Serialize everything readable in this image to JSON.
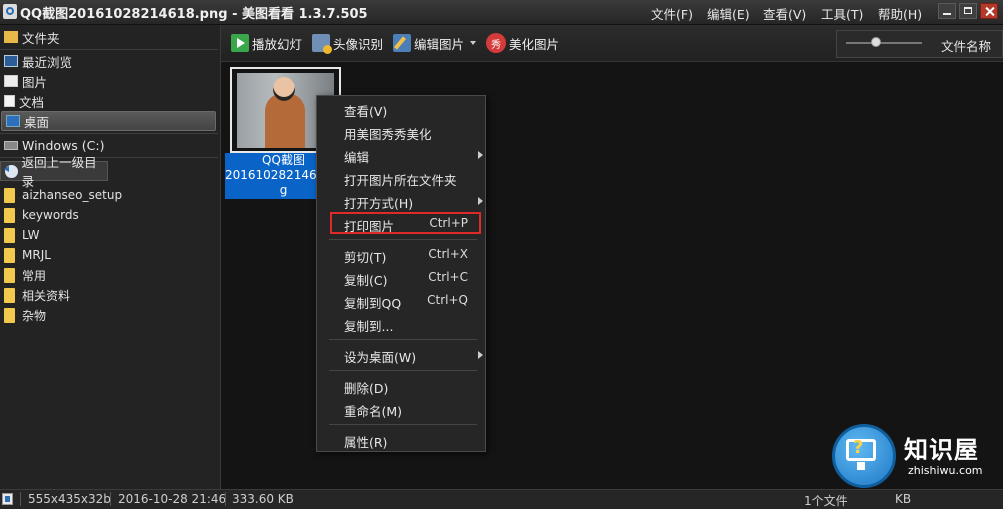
{
  "window": {
    "title": "QQ截图20161028214618.png - 美图看看 1.3.7.505",
    "menu": [
      "文件(F)",
      "编辑(E)",
      "查看(V)",
      "工具(T)",
      "帮助(H)"
    ]
  },
  "sidebar": {
    "header": "文件夹",
    "quick": [
      {
        "label": "最近浏览",
        "icon": "monitor-icon"
      },
      {
        "label": "图片",
        "icon": "picture-icon"
      },
      {
        "label": "文档",
        "icon": "document-icon"
      },
      {
        "label": "桌面",
        "icon": "desktop-icon",
        "selected": true
      }
    ],
    "drive": "Windows (C:)",
    "back": "返回上一级目录",
    "folders": [
      "aizhanseo_setup",
      "keywords",
      "LW",
      "MRJL",
      "常用",
      "相关资料",
      "杂物"
    ]
  },
  "toolbar": {
    "slideshow": "播放幻灯",
    "face": "头像识别",
    "edit": "编辑图片",
    "beautify": "美化图片",
    "beautify_glyph": "秀",
    "sort": "文件名称",
    "zoom_level": 0.4
  },
  "thumbnail": {
    "caption_line1": "QQ截图",
    "caption_line2": "20161028214618.pn",
    "caption_line3": "g"
  },
  "context_menu": {
    "items": [
      {
        "label": "查看(V)"
      },
      {
        "label": "用美图秀秀美化"
      },
      {
        "label": "编辑",
        "submenu": true
      },
      {
        "label": "打开图片所在文件夹"
      },
      {
        "label": "打开方式(H)",
        "submenu": true
      },
      {
        "label": "打印图片",
        "shortcut": "Ctrl+P",
        "highlighted": true
      },
      {
        "label": "剪切(T)",
        "shortcut": "Ctrl+X"
      },
      {
        "label": "复制(C)",
        "shortcut": "Ctrl+C"
      },
      {
        "label": "复制到QQ",
        "shortcut": "Ctrl+Q"
      },
      {
        "label": "复制到..."
      },
      {
        "label": "设为桌面(W)",
        "submenu": true
      },
      {
        "label": "删除(D)"
      },
      {
        "label": "重命名(M)"
      },
      {
        "label": "属性(R)"
      }
    ]
  },
  "status": {
    "dimensions": "555x435x32b",
    "date": "2016-10-28 21:46",
    "size": "333.60 KB",
    "count": "1个文件",
    "right_fragment": "KB"
  },
  "watermark": {
    "title": "知识屋",
    "url": "zhishiwu.com"
  },
  "colors": {
    "selection": "#0a64c8",
    "highlight_border": "#e02a2a",
    "background": "#141414"
  }
}
